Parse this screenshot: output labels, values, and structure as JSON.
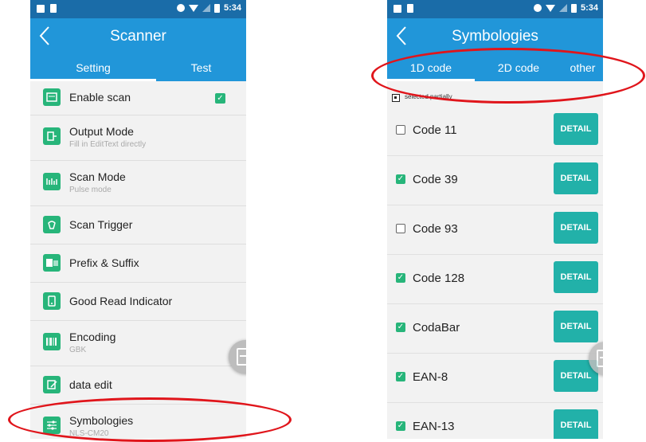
{
  "status_bar": {
    "time": "5:34"
  },
  "left": {
    "title": "Scanner",
    "tabs": [
      {
        "label": "Setting",
        "active": true
      },
      {
        "label": "Test",
        "active": false
      }
    ],
    "items": [
      {
        "title": "Enable scan",
        "subtitle": "",
        "icon": "enable-scan-icon",
        "checked": true
      },
      {
        "title": "Output Mode",
        "subtitle": "Fill in EditText directly",
        "icon": "output-mode-icon"
      },
      {
        "title": "Scan Mode",
        "subtitle": "Pulse mode",
        "icon": "scan-mode-icon"
      },
      {
        "title": "Scan Trigger",
        "subtitle": "",
        "icon": "scan-trigger-icon"
      },
      {
        "title": "Prefix & Suffix",
        "subtitle": "",
        "icon": "prefix-suffix-icon"
      },
      {
        "title": "Good Read Indicator",
        "subtitle": "",
        "icon": "good-read-icon"
      },
      {
        "title": "Encoding",
        "subtitle": "GBK",
        "icon": "encoding-icon"
      },
      {
        "title": "data edit",
        "subtitle": "",
        "icon": "data-edit-icon"
      },
      {
        "title": "Symbologies",
        "subtitle": "NLS-CM20",
        "icon": "symbologies-icon"
      }
    ]
  },
  "right": {
    "title": "Symbologies",
    "tabs": [
      {
        "label": "1D code",
        "active": true
      },
      {
        "label": "2D code",
        "active": false
      },
      {
        "label": "other",
        "active": false
      }
    ],
    "legend": "selected partially",
    "detail_label": "DETAIL",
    "symbologies": [
      {
        "name": "Code 11",
        "checked": false
      },
      {
        "name": "Code 39",
        "checked": true
      },
      {
        "name": "Code 93",
        "checked": false
      },
      {
        "name": "Code 128",
        "checked": true
      },
      {
        "name": "CodaBar",
        "checked": true
      },
      {
        "name": "EAN-8",
        "checked": true
      },
      {
        "name": "EAN-13",
        "checked": true
      }
    ]
  },
  "colors": {
    "status_bar": "#1a6ca8",
    "app_bar": "#2196d9",
    "accent_green": "#27b57a",
    "detail_button": "#22b1a9",
    "annotation_red": "#e0151b"
  }
}
